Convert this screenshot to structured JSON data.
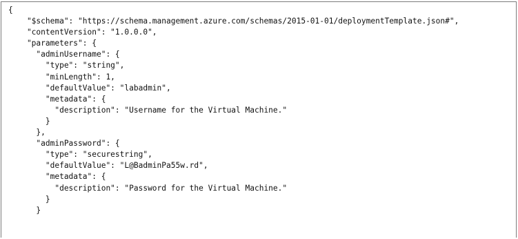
{
  "code": {
    "lines": [
      "{",
      "    \"$schema\": \"https://schema.management.azure.com/schemas/2015-01-01/deploymentTemplate.json#\",",
      "    \"contentVersion\": \"1.0.0.0\",",
      "    \"parameters\": {",
      "      \"adminUsername\": {",
      "        \"type\": \"string\",",
      "        \"minLength\": 1,",
      "        \"defaultValue\": \"labadmin\",",
      "        \"metadata\": {",
      "          \"description\": \"Username for the Virtual Machine.\"",
      "        }",
      "      },",
      "      \"adminPassword\": {",
      "        \"type\": \"securestring\",",
      "        \"defaultValue\": \"L@BadminPa55w.rd\",",
      "        \"metadata\": {",
      "          \"description\": \"Password for the Virtual Machine.\"",
      "        }",
      "      }",
      ""
    ]
  }
}
